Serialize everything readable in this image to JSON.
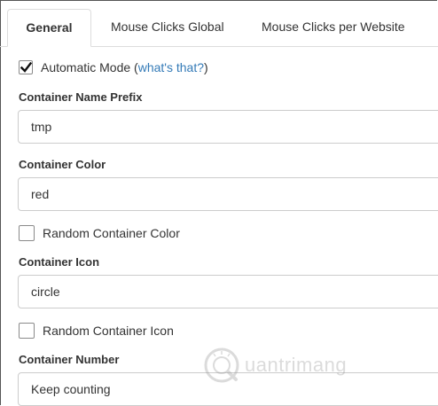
{
  "tabs": [
    {
      "label": "General",
      "active": true
    },
    {
      "label": "Mouse Clicks Global",
      "active": false
    },
    {
      "label": "Mouse Clicks per Website",
      "active": false
    }
  ],
  "automatic_mode": {
    "label": "Automatic Mode (",
    "link": "what's that?",
    "suffix": ")",
    "checked": true
  },
  "fields": {
    "name_prefix": {
      "label": "Container Name Prefix",
      "value": "tmp"
    },
    "color": {
      "label": "Container Color",
      "value": "red"
    },
    "random_color": {
      "label": "Random Container Color",
      "checked": false
    },
    "icon": {
      "label": "Container Icon",
      "value": "circle"
    },
    "random_icon": {
      "label": "Random Container Icon",
      "checked": false
    },
    "number": {
      "label": "Container Number",
      "value": "Keep counting"
    }
  },
  "watermark": {
    "text": "uantrimang"
  },
  "icons": {
    "checkmark": "checkmark-icon",
    "logo": "watermark-logo-icon"
  }
}
